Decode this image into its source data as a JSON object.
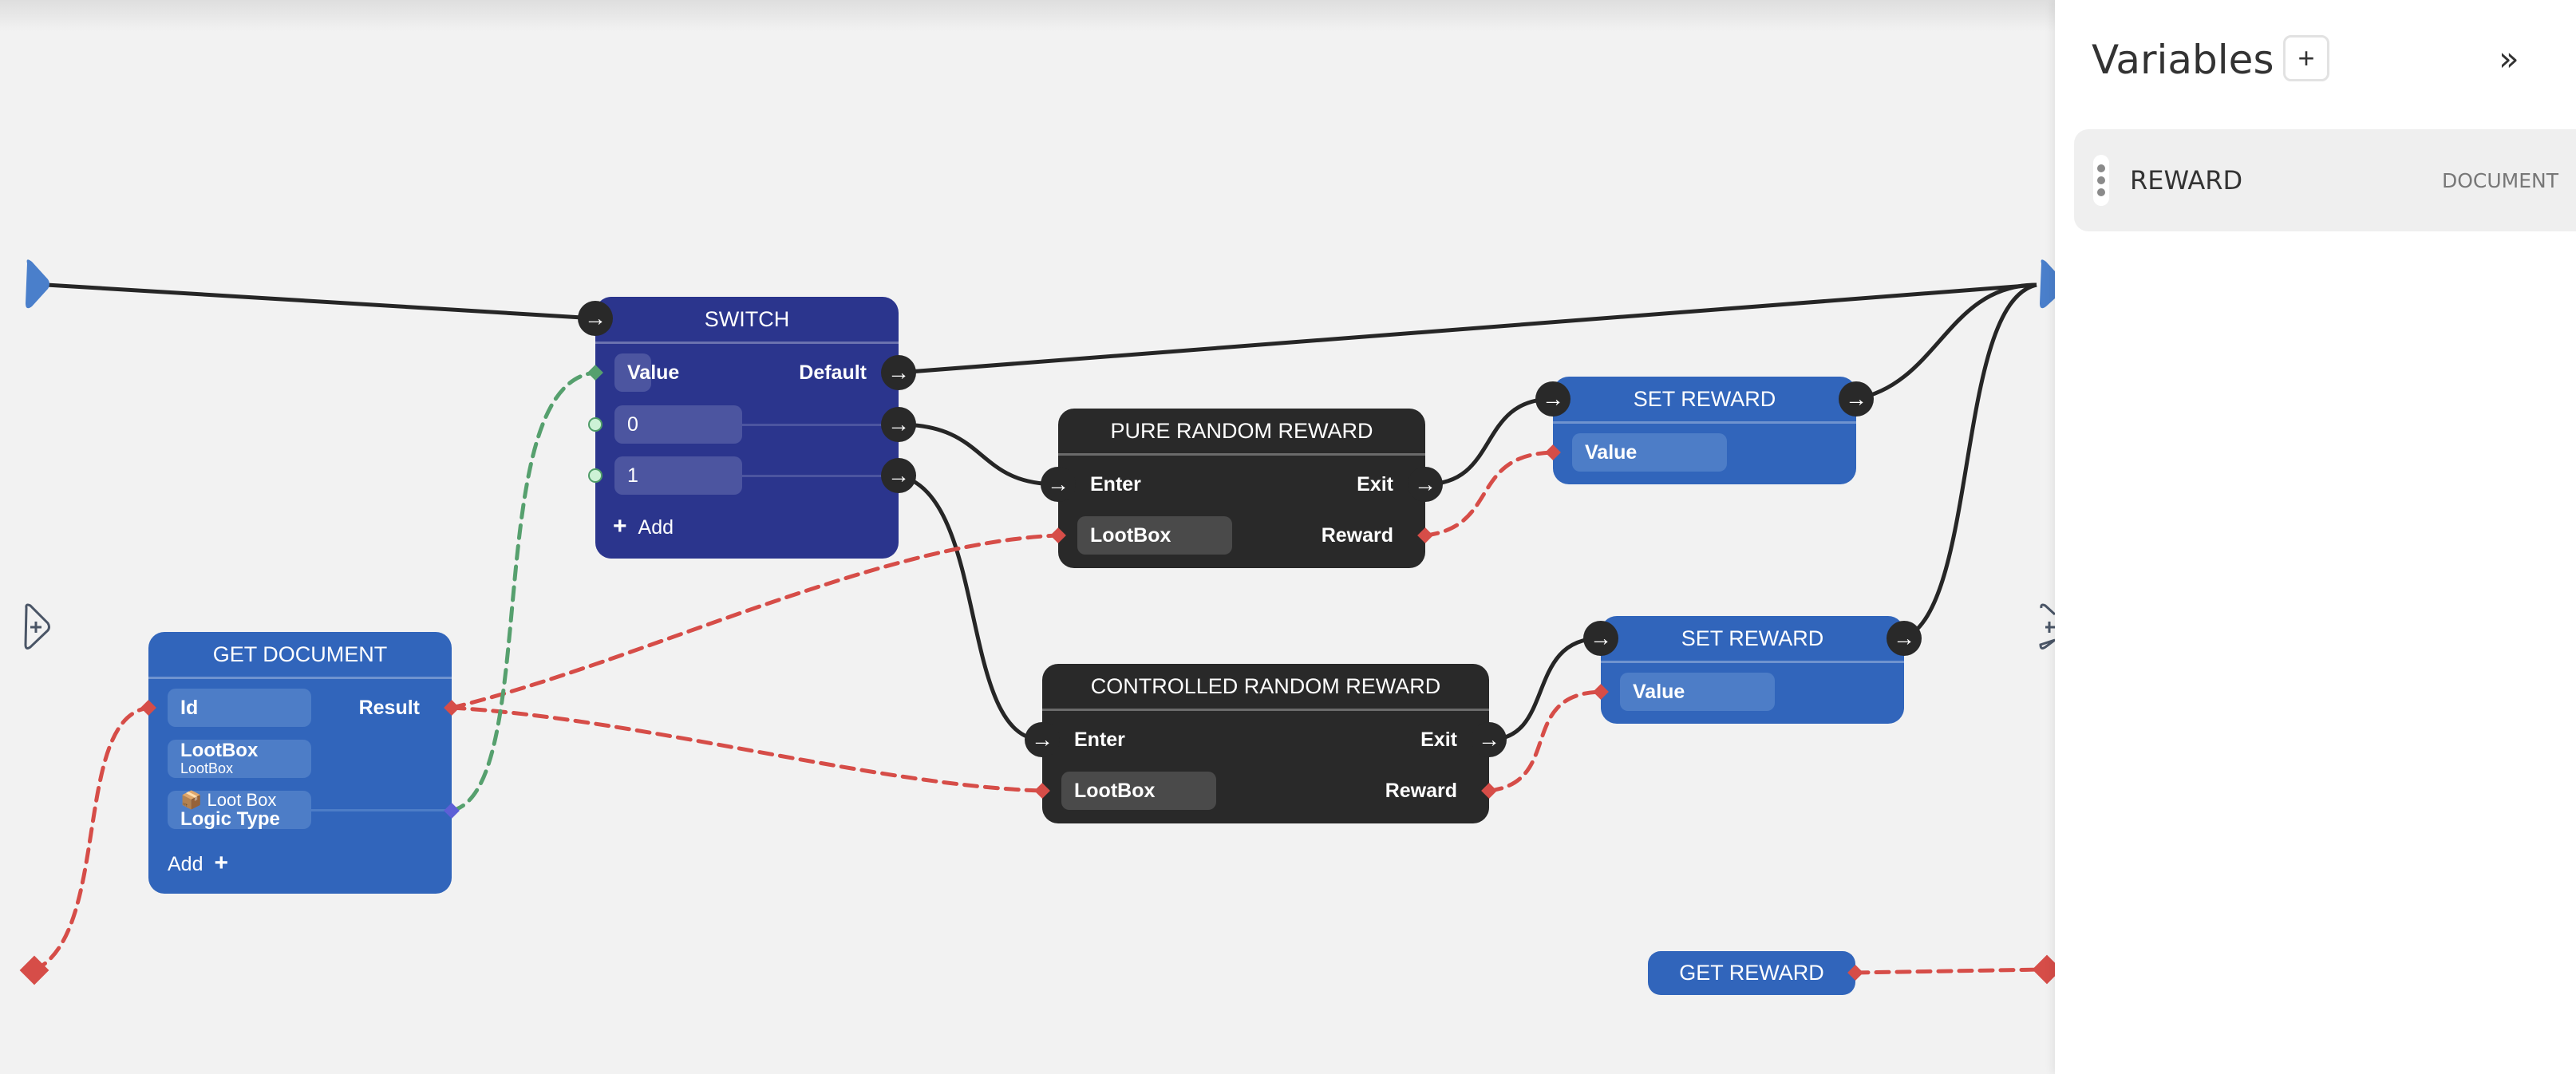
{
  "nodes": {
    "switch": {
      "title": "SWITCH",
      "value_label": "Value",
      "default_label": "Default",
      "cases": [
        "0",
        "1"
      ],
      "add_label": "Add"
    },
    "get_document": {
      "title": "GET DOCUMENT",
      "id_label": "Id",
      "result_label": "Result",
      "collection_label": "LootBox",
      "collection_sub": "LootBox",
      "field_emoji": "📦",
      "field_value": "Loot Box",
      "field_label": "Logic Type",
      "add_label": "Add"
    },
    "pure_random": {
      "title": "PURE RANDOM REWARD",
      "enter_label": "Enter",
      "exit_label": "Exit",
      "lootbox_label": "LootBox",
      "reward_label": "Reward"
    },
    "controlled_random": {
      "title": "CONTROLLED RANDOM REWARD",
      "enter_label": "Enter",
      "exit_label": "Exit",
      "lootbox_label": "LootBox",
      "reward_label": "Reward"
    },
    "set_reward_1": {
      "title": "SET REWARD",
      "value_label": "Value"
    },
    "set_reward_2": {
      "title": "SET REWARD",
      "value_label": "Value"
    },
    "get_reward": {
      "title": "GET REWARD"
    }
  },
  "icons": {
    "flow_arrow": "→",
    "plus": "+",
    "collapse": "»"
  },
  "panel": {
    "title": "Variables",
    "add_button": "+",
    "collapse_button": "»",
    "variables": [
      {
        "name": "REWARD",
        "type": "DOCUMENT"
      }
    ]
  },
  "colors": {
    "canvas": "#f2f2f2",
    "node_blue": "#3165bb",
    "node_navy": "#2b358d",
    "node_dark": "#292929",
    "flow_wire": "#262626",
    "data_wire_red": "#d64d48",
    "data_wire_green": "#56a06e",
    "port_purple": "#5d5fd6",
    "entry_blue": "#4a7fcb"
  }
}
